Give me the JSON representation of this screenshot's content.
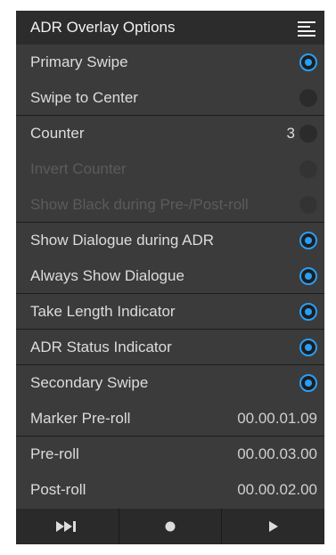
{
  "header": {
    "title": "ADR Overlay Options",
    "menu_icon": "hamburger-menu-icon"
  },
  "accent_color": "#2a9df4",
  "rows": [
    {
      "label": "Primary Swipe",
      "state": "on"
    },
    {
      "label": "Swipe to Center",
      "state": "off"
    },
    {
      "label": "Counter",
      "state": "off",
      "counter_value": "3"
    },
    {
      "label": "Invert Counter",
      "state": "disabled"
    },
    {
      "label": "Show Black during Pre-/Post-roll",
      "state": "disabled"
    },
    {
      "label": "Show Dialogue during ADR",
      "state": "on"
    },
    {
      "label": "Always Show Dialogue",
      "state": "on"
    },
    {
      "label": "Take Length Indicator",
      "state": "on"
    },
    {
      "label": "ADR Status Indicator",
      "state": "on"
    },
    {
      "label": "Secondary Swipe",
      "state": "on"
    },
    {
      "label": "Marker Pre-roll",
      "value": "00.00.01.09"
    },
    {
      "label": "Pre-roll",
      "value": "00.00.03.00"
    },
    {
      "label": "Post-roll",
      "value": "00.00.02.00"
    }
  ],
  "footer": {
    "buttons": [
      {
        "icon": "skip-forward-icon"
      },
      {
        "icon": "record-icon"
      },
      {
        "icon": "play-icon"
      }
    ]
  }
}
